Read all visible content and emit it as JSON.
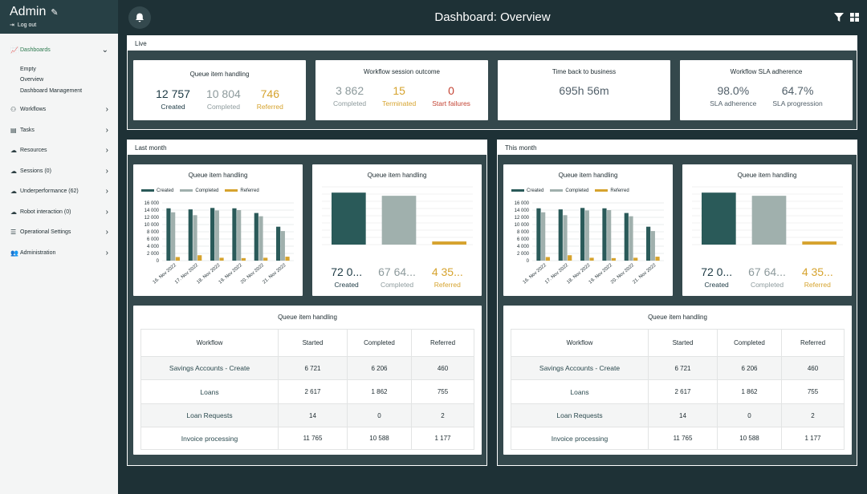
{
  "sidebar": {
    "title": "Admin",
    "logout": "Log out",
    "dashboards": "Dashboards",
    "sub": [
      "Empty",
      "Overview",
      "Dashboard Management"
    ],
    "items": [
      "Workflows",
      "Tasks",
      "Resources",
      "Sessions (0)",
      "Underperformance (62)",
      "Robot interaction (0)",
      "Operational Settings",
      "Administration"
    ]
  },
  "header": {
    "title": "Dashboard: Overview"
  },
  "live": {
    "label": "Live",
    "queue": {
      "title": "Queue item handling",
      "stats": [
        {
          "value": "12 757",
          "label": "Created"
        },
        {
          "value": "10 804",
          "label": "Completed"
        },
        {
          "value": "746",
          "label": "Referred"
        }
      ]
    },
    "session": {
      "title": "Workflow session outcome",
      "stats": [
        {
          "value": "3 862",
          "label": "Completed"
        },
        {
          "value": "15",
          "label": "Terminated"
        },
        {
          "value": "0",
          "label": "Start failures"
        }
      ]
    },
    "time": {
      "title": "Time back to business",
      "value": "695h 56m"
    },
    "sla": {
      "title": "Workflow SLA adherence",
      "stats": [
        {
          "value": "98.0%",
          "label": "SLA adherence"
        },
        {
          "value": "64.7%",
          "label": "SLA progression"
        }
      ]
    }
  },
  "last_month": {
    "label": "Last month",
    "bar_title": "Queue item handling",
    "totals_title": "Queue item handling",
    "totals": [
      {
        "value": "72 0...",
        "label": "Created"
      },
      {
        "value": "67 64...",
        "label": "Completed"
      },
      {
        "value": "4 35...",
        "label": "Referred"
      }
    ],
    "table_title": "Queue item handling"
  },
  "this_month": {
    "label": "This month",
    "bar_title": "Queue item handling",
    "totals_title": "Queue item handling",
    "totals": [
      {
        "value": "72 0...",
        "label": "Created"
      },
      {
        "value": "67 64...",
        "label": "Completed"
      },
      {
        "value": "4 35...",
        "label": "Referred"
      }
    ],
    "table_title": "Queue item handling"
  },
  "legend": [
    "Created",
    "Completed",
    "Referred"
  ],
  "table": {
    "headers": [
      "Workflow",
      "Started",
      "Completed",
      "Referred"
    ],
    "rows": [
      [
        "Savings Accounts - Create",
        "6 721",
        "6 206",
        "460"
      ],
      [
        "Loans",
        "2 617",
        "1 862",
        "755"
      ],
      [
        "Loan Requests",
        "14",
        "0",
        "2"
      ],
      [
        "Invoice processing",
        "11 765",
        "10 588",
        "1 177"
      ]
    ]
  },
  "chart_data": [
    {
      "type": "bar",
      "title": "Queue item handling",
      "categories": [
        "16. Nov 2022",
        "17. Nov 2022",
        "18. Nov 2022",
        "19. Nov 2022",
        "20. Nov 2022",
        "21. Nov 2022"
      ],
      "series": [
        {
          "name": "Created",
          "values": [
            14500,
            14200,
            14600,
            14500,
            13200,
            9400
          ]
        },
        {
          "name": "Completed",
          "values": [
            13400,
            12600,
            13900,
            14000,
            12300,
            8200
          ]
        },
        {
          "name": "Referred",
          "values": [
            1000,
            1500,
            800,
            700,
            800,
            1100
          ]
        }
      ],
      "ylim": [
        0,
        16000
      ],
      "yticks": [
        "0",
        "2 000",
        "4 000",
        "6 000",
        "8 000",
        "10 000",
        "12 000",
        "14 000",
        "16 000"
      ],
      "grid": true,
      "legend": "top-left"
    },
    {
      "type": "bar",
      "title": "Queue item handling",
      "categories": [
        "Created",
        "Completed",
        "Referred"
      ],
      "values": [
        72000,
        67640,
        4350
      ],
      "grid": true
    }
  ],
  "colors": {
    "created": "#2a5a59",
    "completed": "#a0b0ad",
    "referred": "#d6a32e"
  }
}
